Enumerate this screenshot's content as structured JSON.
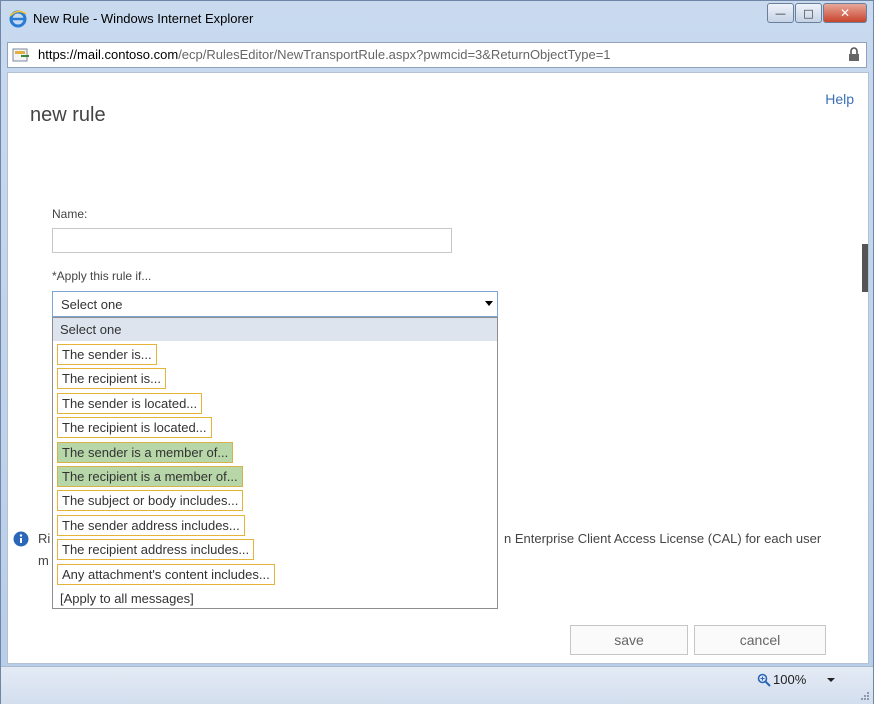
{
  "window": {
    "title": "New Rule - Windows Internet Explorer",
    "minimize": "—",
    "maximize": "□",
    "close": "✕"
  },
  "address": {
    "protocol": "https://",
    "host": "mail.contoso.com",
    "path": "/ecp/RulesEditor/NewTransportRule.aspx?pwmcid=3&ReturnObjectType=1"
  },
  "page": {
    "help": "Help",
    "title": "new rule",
    "name_label": "Name:",
    "name_value": "",
    "apply_label": "*Apply this rule if...",
    "select_value": "Select one"
  },
  "dropdown": {
    "options": [
      {
        "label": "Select one",
        "state": "selected"
      },
      {
        "label": "The sender is...",
        "state": "boxed"
      },
      {
        "label": "The recipient is...",
        "state": "boxed"
      },
      {
        "label": "The sender is located...",
        "state": "boxed"
      },
      {
        "label": "The recipient is located...",
        "state": "boxed"
      },
      {
        "label": "The sender is a member of...",
        "state": "green"
      },
      {
        "label": "The recipient is a member of...",
        "state": "green"
      },
      {
        "label": "The subject or body includes...",
        "state": "boxed"
      },
      {
        "label": "The sender address includes...",
        "state": "boxed"
      },
      {
        "label": "The recipient address includes...",
        "state": "boxed"
      },
      {
        "label": "Any attachment's content includes...",
        "state": "boxed"
      },
      {
        "label": "[Apply to all messages]",
        "state": "plain"
      }
    ]
  },
  "info": {
    "left_fragment": "Ri",
    "left_fragment2": "m",
    "right_fragment": "n Enterprise Client Access License (CAL) for each user"
  },
  "buttons": {
    "save": "save",
    "cancel": "cancel"
  },
  "status": {
    "zoom": "100%"
  },
  "colors": {
    "link": "#3b6fb6",
    "option_border": "#e4b43a",
    "option_green": "#b7d7a8"
  }
}
